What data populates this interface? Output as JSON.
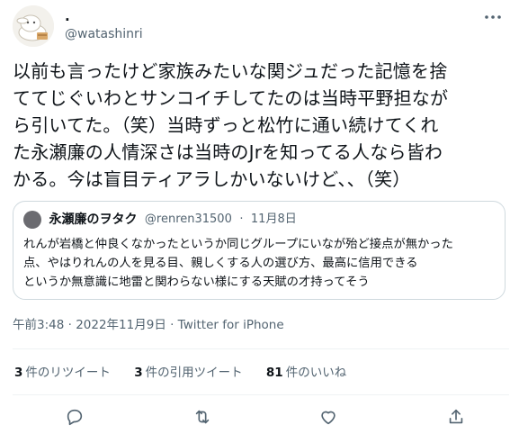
{
  "author": {
    "display_name": ".",
    "handle": "@watashinri"
  },
  "tweet": {
    "text": "以前も言ったけど家族みたいな関ジュだった記憶を捨\nててじぐいわとサンコイチしてたのは当時平野担なが\nら引いてた。（笑）当時ずっと松竹に通い続けてくれ\nた永瀬廉の人情深さは当時のJrを知ってる人なら皆わ\nかる。今は盲目ティアラしかいないけど、、（笑）"
  },
  "quoted_tweet": {
    "display_name": "永瀬廉のヲタク",
    "handle": "@renren31500",
    "separator": "·",
    "date": "11月8日",
    "text": "れんが岩橋と仲良くなかったというか同じグループにいなが殆ど接点が無かった\n点、やはりれんの人を見る目、親しくする人の選び方、最高に信用できる\nというか無意識に地雷と関わらない様にする天賦の才持ってそう"
  },
  "meta": {
    "timestamp": "午前3:48 · 2022年11月9日 · Twitter for iPhone"
  },
  "stats": {
    "retweets_count": "3",
    "retweets_label": "件のリツイート",
    "quotes_count": "3",
    "quotes_label": "件の引用ツイート",
    "likes_count": "81",
    "likes_label": "件のいいね"
  },
  "icons": {
    "more": "more-icon",
    "reply": "reply-icon",
    "retweet": "retweet-icon",
    "like": "like-icon",
    "share": "share-icon"
  },
  "colors": {
    "text_primary": "#0f1419",
    "text_secondary": "#536471",
    "border": "#cfd9de",
    "divider": "#eff3f4"
  }
}
